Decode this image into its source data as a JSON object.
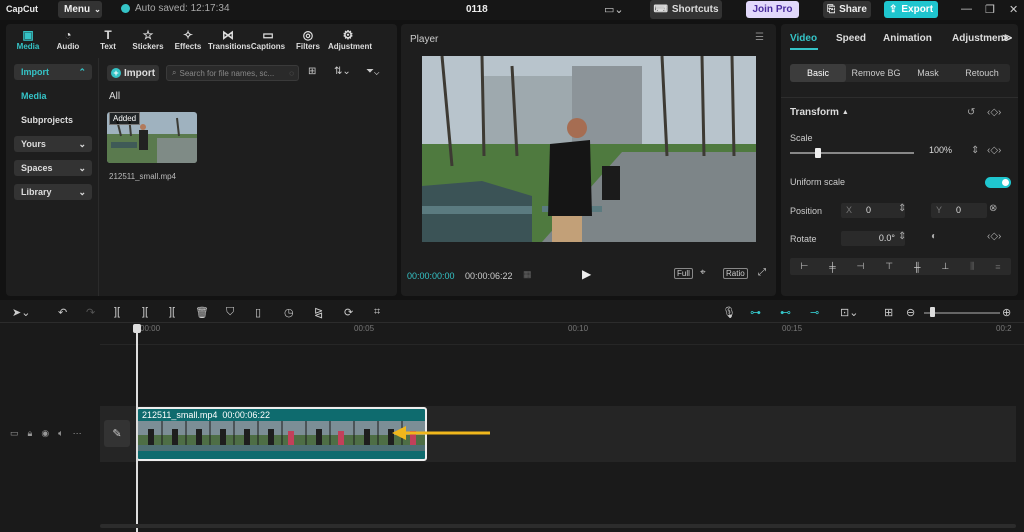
{
  "topbar": {
    "logo": "CapCut",
    "menu_label": "Menu",
    "autosave": "Auto saved: 12:17:34",
    "project_name": "0118",
    "shortcuts": "Shortcuts",
    "join_pro": "Join Pro",
    "share": "Share",
    "export": "Export"
  },
  "media_tabs": [
    {
      "label": "Media",
      "icon": "media-icon"
    },
    {
      "label": "Audio",
      "icon": "audio-icon"
    },
    {
      "label": "Text",
      "icon": "text-icon"
    },
    {
      "label": "Stickers",
      "icon": "stickers-icon"
    },
    {
      "label": "Effects",
      "icon": "effects-icon"
    },
    {
      "label": "Transitions",
      "icon": "transitions-icon"
    },
    {
      "label": "Captions",
      "icon": "captions-icon"
    },
    {
      "label": "Filters",
      "icon": "filters-icon"
    },
    {
      "label": "Adjustment",
      "icon": "adjustment-icon"
    }
  ],
  "sidebar": {
    "import": "Import",
    "media": "Media",
    "subprojects": "Subprojects",
    "yours": "Yours",
    "spaces": "Spaces",
    "library": "Library"
  },
  "media": {
    "import_button": "Import",
    "search_placeholder": "Search for file names, sc...",
    "filter_all": "All",
    "item_badge": "Added",
    "item_name": "212511_small.mp4"
  },
  "player": {
    "title": "Player",
    "current_time": "00:00:00:00",
    "duration": "00:00:06:22",
    "full": "Full",
    "ratio": "Ratio"
  },
  "props": {
    "tabs": [
      "Video",
      "Speed",
      "Animation",
      "Adjustment"
    ],
    "subtabs": [
      "Basic",
      "Remove BG",
      "Mask",
      "Retouch"
    ],
    "transform": "Transform",
    "scale_label": "Scale",
    "scale_value": "100%",
    "scale_fraction": 0.2,
    "uniform_scale": "Uniform scale",
    "uniform_scale_on": true,
    "position_label": "Position",
    "pos_x_label": "X",
    "pos_x": "0",
    "pos_y_label": "Y",
    "pos_y": "0",
    "rotate_label": "Rotate",
    "rotate_value": "0.0°"
  },
  "timeline": {
    "ruler": [
      "00:00",
      "00:05",
      "00:10",
      "00:15",
      "00:2"
    ],
    "clip_name": "212511_small.mp4",
    "clip_duration": "00:00:06:22"
  },
  "colors": {
    "accent": "#35c4c7",
    "export": "#1fc6cf",
    "join_pro_bg": "#e2d9fb",
    "arrow": "#f0b71c"
  }
}
